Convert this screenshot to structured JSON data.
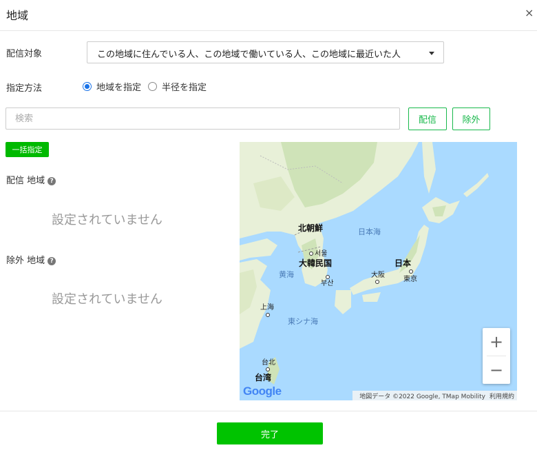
{
  "header": {
    "title": "地域",
    "close": "×"
  },
  "target": {
    "label": "配信対象",
    "selected": "この地域に住んでいる人、この地域で働いている人、この地域に最近いた人"
  },
  "method": {
    "label": "指定方法",
    "options": [
      {
        "label": "地域を指定",
        "checked": true
      },
      {
        "label": "半径を指定",
        "checked": false
      }
    ]
  },
  "search": {
    "placeholder": "検索",
    "value": ""
  },
  "buttons": {
    "deliver": "配信",
    "exclude": "除外",
    "bulk": "一括指定",
    "done": "完了"
  },
  "deliver_area": {
    "label": "配信 地域",
    "help": "?",
    "empty": "設定されていません"
  },
  "exclude_area": {
    "label": "除外 地域",
    "help": "?",
    "empty": "設定されていません"
  },
  "map": {
    "labels": {
      "north_korea": "北朝鮮",
      "seoul": "서울",
      "south_korea": "大韓民国",
      "busan": "부산",
      "sea_of_japan": "日本海",
      "japan": "日本",
      "osaka": "大阪",
      "tokyo": "東京",
      "yellow_sea": "黄海",
      "shanghai": "上海",
      "east_china_sea": "東シナ海",
      "taipei": "台北",
      "taiwan": "台湾"
    },
    "zoom_in": "+",
    "zoom_out": "−",
    "logo": "Google",
    "attribution": "地図データ ©2022 Google, TMap Mobility",
    "terms": "利用規約",
    "colors": {
      "sea": "#aadaff",
      "land": "#e8f0d8",
      "forest": "#cfe3b8",
      "logo_blue": "#4285f4"
    }
  }
}
